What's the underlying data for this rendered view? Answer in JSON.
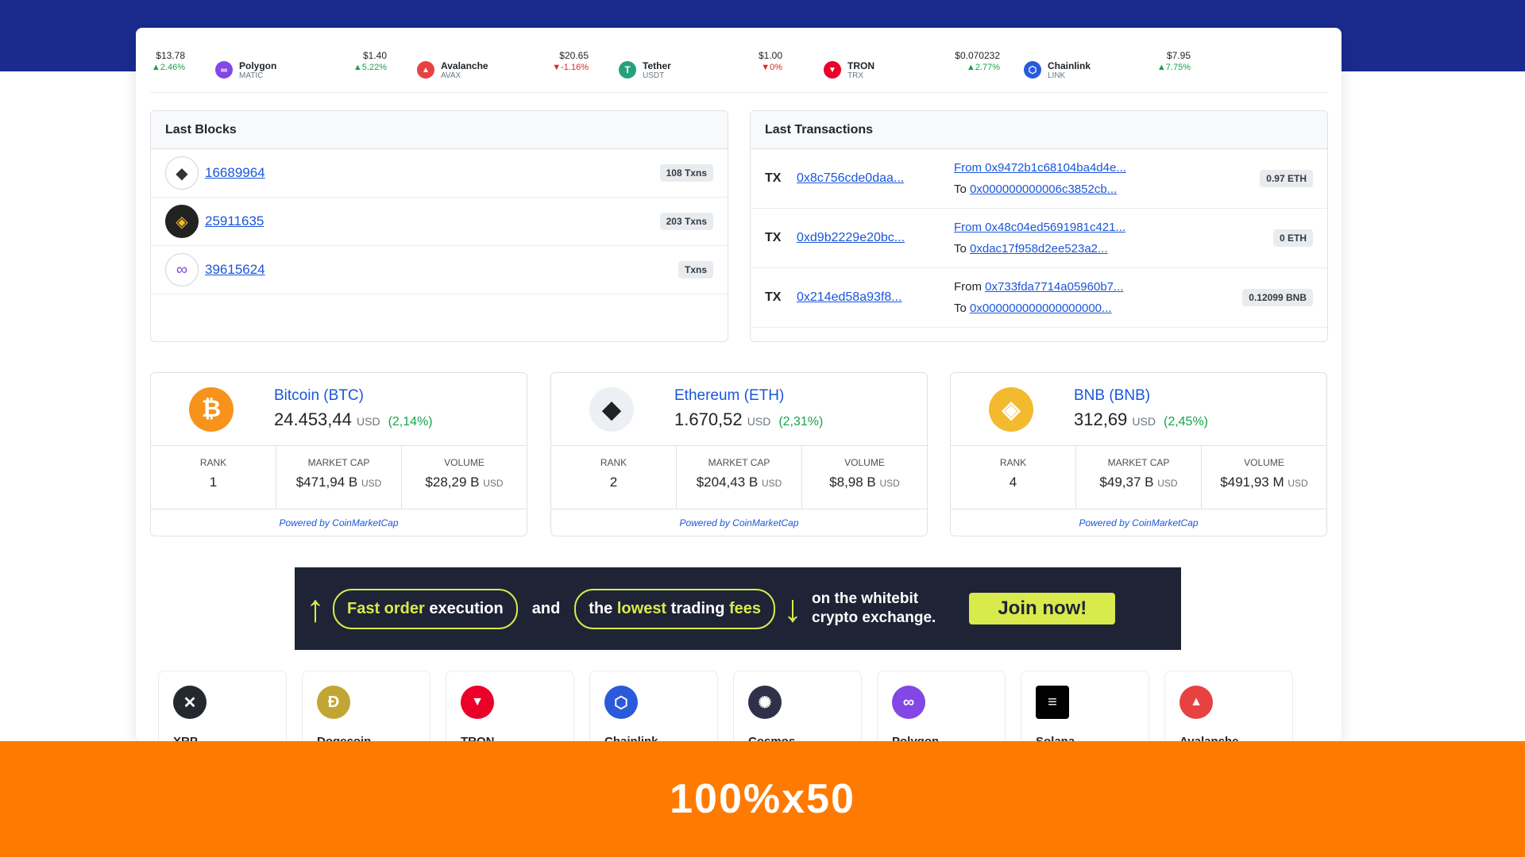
{
  "colors": {
    "top_band": "#1a2b8e",
    "footer": "#ff7a00",
    "link": "#1a56db",
    "up": "#16a34a",
    "down": "#dc2626",
    "banner_bg": "#1f2336",
    "banner_accent": "#d8ea4c"
  },
  "ticker": {
    "lead": {
      "price": "$13.78",
      "change": "▲2.46%"
    },
    "items": [
      {
        "name": "Polygon",
        "symbol": "MATIC",
        "icon": "polygon-icon",
        "price": "$1.40",
        "change": "▲5.22%",
        "dir": "up",
        "color": "#8247e5",
        "glyph": "∞"
      },
      {
        "name": "Avalanche",
        "symbol": "AVAX",
        "icon": "avalanche-icon",
        "price": "$20.65",
        "change": "▼-1.16%",
        "dir": "down",
        "color": "#e84142",
        "glyph": "▲"
      },
      {
        "name": "Tether",
        "symbol": "USDT",
        "icon": "tether-icon",
        "price": "$1.00",
        "change": "▼0%",
        "dir": "down",
        "color": "#26a17b",
        "glyph": "T"
      },
      {
        "name": "TRON",
        "symbol": "TRX",
        "icon": "tron-icon",
        "price": "$0.070232",
        "change": "▲2.77%",
        "dir": "up",
        "color": "#eb0029",
        "glyph": "▼"
      },
      {
        "name": "Chainlink",
        "symbol": "LINK",
        "icon": "chainlink-icon",
        "price": "$7.95",
        "change": "▲7.75%",
        "dir": "up",
        "color": "#2a5ada",
        "glyph": "⬡"
      }
    ]
  },
  "last_blocks": {
    "title": "Last Blocks",
    "rows": [
      {
        "icon": "ethereum-icon",
        "number": "16689964",
        "txns": "108 Txns"
      },
      {
        "icon": "bnb-icon",
        "number": "25911635",
        "txns": "203 Txns"
      },
      {
        "icon": "polygon-icon",
        "number": "39615624",
        "txns": "Txns"
      }
    ]
  },
  "last_transactions": {
    "title": "Last Transactions",
    "rows": [
      {
        "tag": "TX",
        "hash": "0x8c756cde0daa...",
        "from_label": "From",
        "from": "0x9472b1c68104ba4d4e...",
        "to_label": "To",
        "to": "0x000000000006c3852cb...",
        "amount": "0.97 ETH",
        "from_linked_label": true
      },
      {
        "tag": "TX",
        "hash": "0xd9b2229e20bc...",
        "from_label": "From",
        "from": "0x48c04ed5691981c421...",
        "to_label": "To",
        "to": "0xdac17f958d2ee523a2...",
        "amount": "0 ETH",
        "from_linked_label": true
      },
      {
        "tag": "TX",
        "hash": "0x214ed58a93f8...",
        "from_label": "From",
        "from": "0x733fda7714a05960b7...",
        "to_label": "To",
        "to": "0x000000000000000000...",
        "amount": "0.12099 BNB",
        "from_linked_label": false
      }
    ]
  },
  "coins": [
    {
      "icon": "bitcoin-icon",
      "glyph": "₿",
      "color": "#f7931a",
      "name": "Bitcoin (BTC)",
      "price": "24.453,44",
      "currency": "USD",
      "pct": "(2,14%)",
      "rank_label": "RANK",
      "rank": "1",
      "mcap_label": "MARKET CAP",
      "mcap": "$471,94 B",
      "vol_label": "VOLUME",
      "vol": "$28,29 B",
      "unit": "USD",
      "powered": "Powered by CoinMarketCap"
    },
    {
      "icon": "ethereum-icon",
      "glyph": "◆",
      "color": "#eceff3",
      "name": "Ethereum (ETH)",
      "price": "1.670,52",
      "currency": "USD",
      "pct": "(2,31%)",
      "rank_label": "RANK",
      "rank": "2",
      "mcap_label": "MARKET CAP",
      "mcap": "$204,43 B",
      "vol_label": "VOLUME",
      "vol": "$8,98 B",
      "unit": "USD",
      "powered": "Powered by CoinMarketCap"
    },
    {
      "icon": "bnb-icon",
      "glyph": "◈",
      "color": "#f3ba2f",
      "name": "BNB (BNB)",
      "price": "312,69",
      "currency": "USD",
      "pct": "(2,45%)",
      "rank_label": "RANK",
      "rank": "4",
      "mcap_label": "MARKET CAP",
      "mcap": "$49,37 B",
      "vol_label": "VOLUME",
      "vol": "$491,93 M",
      "unit": "USD",
      "powered": "Powered by CoinMarketCap"
    }
  ],
  "banner": {
    "pill1_a": "Fast order",
    "pill1_b": " execution",
    "and": "and",
    "pill2_a": "the ",
    "pill2_b": "lowest",
    "pill2_c": " trading ",
    "pill2_d": "fees",
    "wb_line1": "on the  whitebit",
    "wb_line2": "crypto exchange.",
    "cta": "Join now!"
  },
  "mini_coins": [
    {
      "name": "XRP",
      "icon": "xrp-icon",
      "color": "#23292f",
      "glyph": "✕"
    },
    {
      "name": "Dogecoin",
      "icon": "dogecoin-icon",
      "color": "#c2a633",
      "glyph": "Ð"
    },
    {
      "name": "TRON",
      "icon": "tron-icon",
      "color": "#eb0029",
      "glyph": "▼"
    },
    {
      "name": "Chainlink",
      "icon": "chainlink-icon",
      "color": "#2a5ada",
      "glyph": "⬡"
    },
    {
      "name": "Cosmos",
      "icon": "cosmos-icon",
      "color": "#2e3148",
      "glyph": "✺"
    },
    {
      "name": "Polygon",
      "icon": "polygon-icon",
      "color": "#8247e5",
      "glyph": "∞"
    },
    {
      "name": "Solana",
      "icon": "solana-icon",
      "color": "#000000",
      "glyph": "≡"
    },
    {
      "name": "Avalanche",
      "icon": "avalanche-icon",
      "color": "#e84142",
      "glyph": "▲"
    }
  ],
  "footer": {
    "text": "100%x50"
  }
}
